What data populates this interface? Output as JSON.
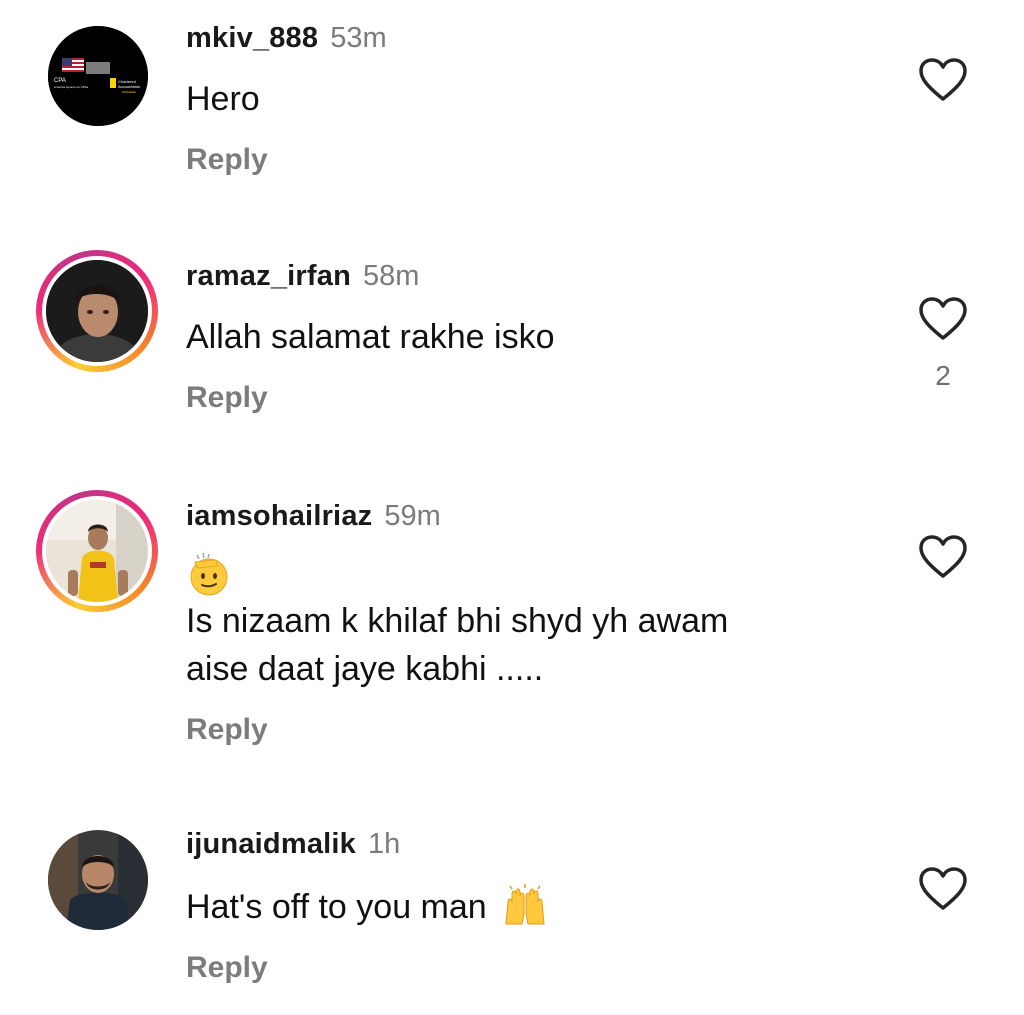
{
  "comments": [
    {
      "username": "mkiv_888",
      "time": "53m",
      "text": "Hero",
      "reply_label": "Reply",
      "avatar_text": {
        "line1": "CPA",
        "line2": "America Lipunto on CPAs",
        "line3": "Chartered",
        "line4": "Accountants",
        "line5": "Worldwide"
      }
    },
    {
      "username": "ramaz_irfan",
      "time": "58m",
      "text": "Allah salamat rakhe isko",
      "reply_label": "Reply",
      "like_count": "2"
    },
    {
      "username": "iamsohailriaz",
      "time": "59m",
      "emoji": "saluting-face",
      "text_line1": "Is nizaam k khilaf bhi shyd yh awam",
      "text_line2": "aise daat jaye kabhi .....",
      "reply_label": "Reply"
    },
    {
      "username": "ijunaidmalik",
      "time": "1h",
      "text": "Hat's off to you man",
      "emoji": "raising-hands",
      "reply_label": "Reply"
    }
  ],
  "colors": {
    "username": "#1a1a1a",
    "meta_gray": "#7b7b7b",
    "heart_stroke": "#262626"
  },
  "icons": [
    "heart-outline-icon",
    "saluting-face-emoji",
    "raising-hands-emoji"
  ]
}
